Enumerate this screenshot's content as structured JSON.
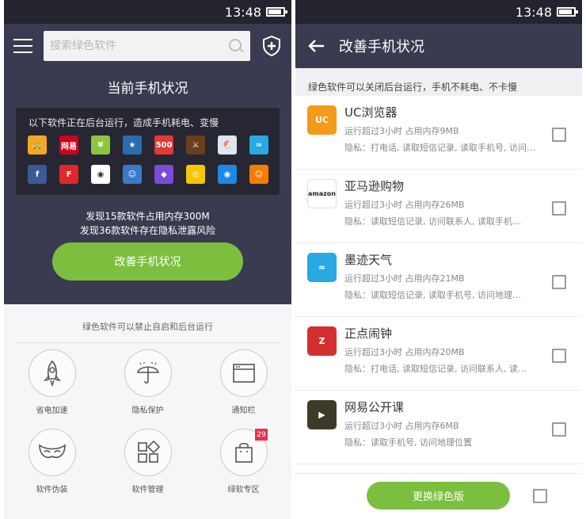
{
  "status_bar": {
    "time": "13:48"
  },
  "left": {
    "search": {
      "placeholder": "搜索绿色软件"
    },
    "status_title": "当前手机状况",
    "background_panel": {
      "text": "以下软件正在后台运行，造成手机耗电、变慢",
      "apps": [
        {
          "name": "didi",
          "color": "#f5a623",
          "glyph": "🚕"
        },
        {
          "name": "netease-news",
          "color": "#d0021b",
          "glyph": "网易"
        },
        {
          "name": "yellow-app",
          "color": "#8cc63f",
          "glyph": "¥"
        },
        {
          "name": "star-app",
          "color": "#2b6cb0",
          "glyph": "★"
        },
        {
          "name": "500-app",
          "color": "#e53935",
          "glyph": "500"
        },
        {
          "name": "clash-game",
          "color": "#6b3e1e",
          "glyph": "⚔"
        },
        {
          "name": "chicken-app",
          "color": "#dfe6ee",
          "glyph": "🐔"
        },
        {
          "name": "moji-small",
          "color": "#29a9e1",
          "glyph": "≈"
        },
        {
          "name": "facebook",
          "color": "#3b5998",
          "glyph": "f"
        },
        {
          "name": "flipboard",
          "color": "#e12828",
          "glyph": "F"
        },
        {
          "name": "camera-app",
          "color": "#ffffff",
          "glyph": "◉"
        },
        {
          "name": "subway-game",
          "color": "#3a78c9",
          "glyph": "☺"
        },
        {
          "name": "prism-app",
          "color": "#7b4bd6",
          "glyph": "◆"
        },
        {
          "name": "radio-app",
          "color": "#f7c600",
          "glyph": "◎"
        },
        {
          "name": "pinpoint-app",
          "color": "#1e88e5",
          "glyph": "◉"
        },
        {
          "name": "smile-app",
          "color": "#f57c00",
          "glyph": "☺"
        }
      ]
    },
    "found_lines": [
      "发现15款软件占用内存300M",
      "发现36款软件存在隐私泄露风险"
    ],
    "improve_button": "改善手机状况",
    "feature_note": "绿色软件可以禁止自启和后台运行",
    "features": [
      {
        "label": "省电加速",
        "icon": "rocket-icon"
      },
      {
        "label": "隐私保护",
        "icon": "umbrella-icon"
      },
      {
        "label": "通知栏",
        "icon": "window-icon"
      },
      {
        "label": "软件伪装",
        "icon": "mask-icon"
      },
      {
        "label": "软件管理",
        "icon": "grid-icon"
      },
      {
        "label": "绿软专区",
        "icon": "bag-icon",
        "badge": "29"
      }
    ]
  },
  "right": {
    "title": "改善手机状况",
    "subtitle": "绿色软件可以关闭后台运行，手机不耗电、不卡慢",
    "apps": [
      {
        "name": "UC浏览器",
        "mem": "运行超过3小时 占用内存9MB",
        "privacy": "隐私：打电话, 读取短信记录, 读取手机号, 访问…",
        "icon": "uc-browser-icon",
        "color": "#f39a1b",
        "glyph": "UC"
      },
      {
        "name": "亚马逊购物",
        "mem": "运行超过3小时 占用内存26MB",
        "privacy": "隐私：读取短信记录, 访问联系人, 读取手机…",
        "icon": "amazon-icon",
        "color": "#ffffff",
        "glyph": "amazon"
      },
      {
        "name": "墨迹天气",
        "mem": "运行超过3小时 占用内存21MB",
        "privacy": "隐私：读取短信记录, 读取手机号, 访问地理…",
        "icon": "moji-weather-icon",
        "color": "#29a9e1",
        "glyph": "≈"
      },
      {
        "name": "正点闹钟",
        "mem": "运行超过3小时 占用内存20MB",
        "privacy": "隐私：打电话, 读取短信记录, 访问联系人, 读…",
        "icon": "alarm-clock-icon",
        "color": "#d32f2f",
        "glyph": "Z"
      },
      {
        "name": "网易公开课",
        "mem": "运行超过3小时 占用内存6MB",
        "privacy": "隐私：读取手机号, 访问地理位置",
        "icon": "netease-open-course-icon",
        "color": "#3e3a2a",
        "glyph": "▶"
      }
    ],
    "switch_button": "更换绿色版"
  },
  "colors": {
    "header_dark": "#3a3b50",
    "accent_green": "#7cbf3e",
    "panel_dark": "#262733"
  }
}
